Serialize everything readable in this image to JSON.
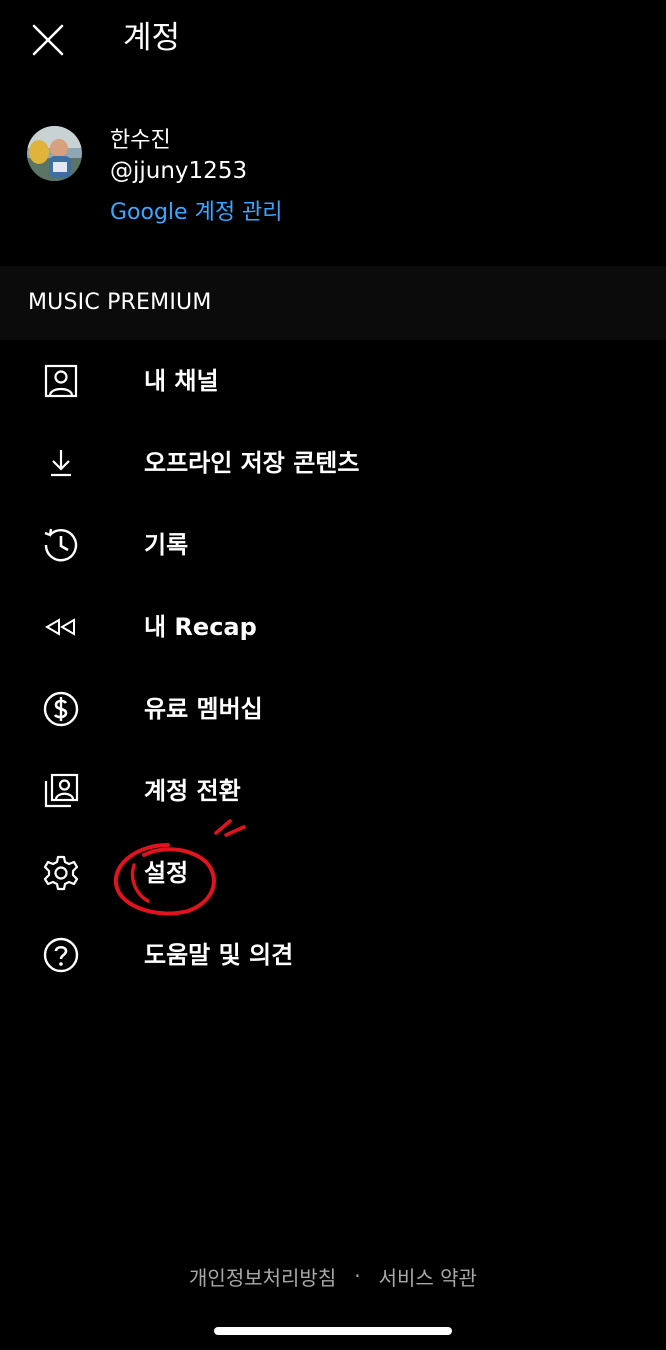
{
  "header": {
    "title": "계정",
    "close_icon": "close-icon"
  },
  "profile": {
    "name": "한수진",
    "handle": "@jjuny1253",
    "manage_link": "Google 계정 관리"
  },
  "section": {
    "label": "MUSIC PREMIUM"
  },
  "menu": {
    "items": [
      {
        "label": "내 채널",
        "icon": "person-box-icon"
      },
      {
        "label": "오프라인 저장 콘텐츠",
        "icon": "download-icon"
      },
      {
        "label": "기록",
        "icon": "history-icon"
      },
      {
        "label": "내 Recap",
        "icon": "rewind-icon"
      },
      {
        "label": "유료 멤버십",
        "icon": "dollar-circle-icon"
      },
      {
        "label": "계정 전환",
        "icon": "switch-account-icon"
      },
      {
        "label": "설정",
        "icon": "gear-icon"
      },
      {
        "label": "도움말 및 의견",
        "icon": "help-icon"
      }
    ]
  },
  "footer": {
    "privacy": "개인정보처리방침",
    "separator": "·",
    "terms": "서비스 약관"
  },
  "colors": {
    "background": "#000000",
    "link": "#3ea6ff",
    "annotation": "#e0141e",
    "footer_text": "#a8a8a8"
  }
}
